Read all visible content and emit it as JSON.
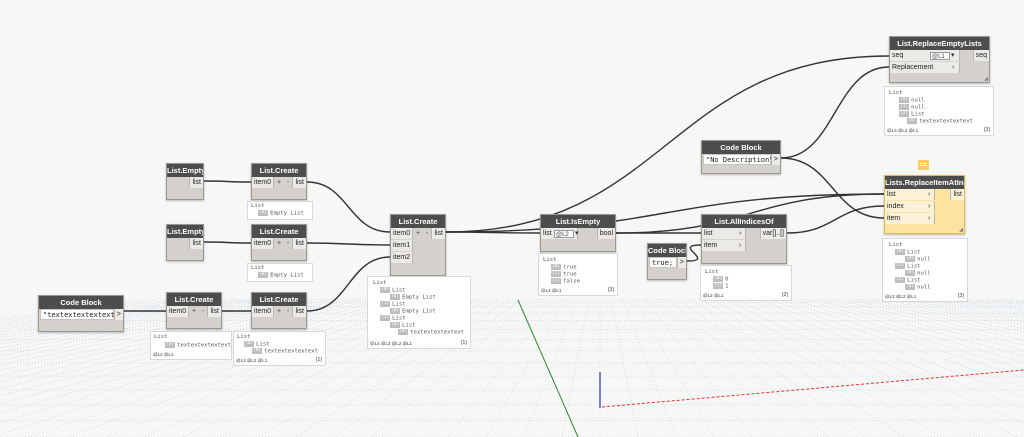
{
  "nodes": {
    "empty1": {
      "title": "List.Empty",
      "out": "list"
    },
    "empty2": {
      "title": "List.Empty",
      "out": "list"
    },
    "code1": {
      "title": "Code Block",
      "code": "\"textextextextext\";",
      "out": ">"
    },
    "create1": {
      "title": "List.Create",
      "in": "item0",
      "plus": "+",
      "minus": "-",
      "out": "list"
    },
    "create2": {
      "title": "List.Create",
      "in": "item0",
      "plus": "+",
      "minus": "-",
      "out": "list"
    },
    "create3": {
      "title": "List.Create",
      "in": "item0",
      "plus": "+",
      "minus": "-",
      "out": "list"
    },
    "create4": {
      "title": "List.Create",
      "in": "item0",
      "plus": "+",
      "minus": "-",
      "out": "list"
    },
    "createMain": {
      "title": "List.Create",
      "in0": "item0",
      "in1": "item1",
      "in2": "item2",
      "plus": "+",
      "minus": "-",
      "out": "list"
    },
    "isEmpty": {
      "title": "List.IsEmpty",
      "in": "list",
      "lacing": "@L2",
      "out": "bool"
    },
    "code2": {
      "title": "Code Block",
      "code": "true;",
      "out": ">"
    },
    "allIndices": {
      "title": "List.AllIndicesOf",
      "in0": "list",
      "in1": "item",
      "out": "var[]..[]"
    },
    "code3": {
      "title": "Code Block",
      "code": "\"No Description\";",
      "out": ">"
    },
    "replaceEmpty": {
      "title": "List.ReplaceEmptyLists",
      "in0": "seq",
      "lacing": "@L1",
      "in1": "Replacement",
      "out": "seq"
    },
    "replaceItem": {
      "title": "Lists.ReplaceItemAtIndex",
      "in0": "list",
      "in1": "index",
      "in2": "item",
      "out": "list"
    }
  },
  "previews": {
    "p_create1": {
      "lines": [
        "List",
        "[0] Empty List"
      ]
    },
    "p_create2": {
      "lines": [
        "List",
        "[0] Empty List"
      ]
    },
    "p_create3": {
      "lines": [
        "List",
        "[0] textextextextext"
      ],
      "foot": "@L2 @L1"
    },
    "p_create4": {
      "lines": [
        "List",
        "[0] List",
        "[0] textextextextext"
      ],
      "foot": "@L3 @L2 @L1",
      "count": "{1}"
    },
    "p_main": {
      "lines": [
        "List",
        "[0] List",
        "[0] Empty List",
        "[1] List",
        "[0] Empty List",
        "[2] List",
        "[0] List",
        "[0] textextextextext"
      ],
      "foot": "@L4 @L3 @L2 @L1",
      "count": "{1}"
    },
    "p_isEmpty": {
      "lines": [
        "List",
        "[0] true",
        "[1] true",
        "[2] false"
      ],
      "foot": "@L2 @L1",
      "count": "{3}"
    },
    "p_allIndices": {
      "lines": [
        "List",
        "[0] 0",
        "[1] 1"
      ],
      "foot": "@L2 @L1",
      "count": "{2}"
    },
    "p_replaceEmpty": {
      "lines": [
        "List",
        "[0] null",
        "[1] null",
        "[2] List",
        "[0] textextextextext"
      ],
      "foot": "@L3 @L2 @L1",
      "count": "{3}"
    },
    "p_replaceItem": {
      "lines": [
        "List",
        "[0] List",
        "[0] null",
        "[1] List",
        "[0] null",
        "[2] List",
        "[0] null"
      ],
      "foot": "@L3 @L2 @L1",
      "count": "{3}"
    }
  },
  "colors": {
    "node_header": "#4d4d4d",
    "node_body": "#d4d1cc",
    "selected_body": "#fde3a0",
    "wire": "#333333",
    "grid": "#a9c4d6",
    "axis_x": "#e23232",
    "axis_y": "#2b8a2b",
    "axis_z": "#2532c8"
  }
}
